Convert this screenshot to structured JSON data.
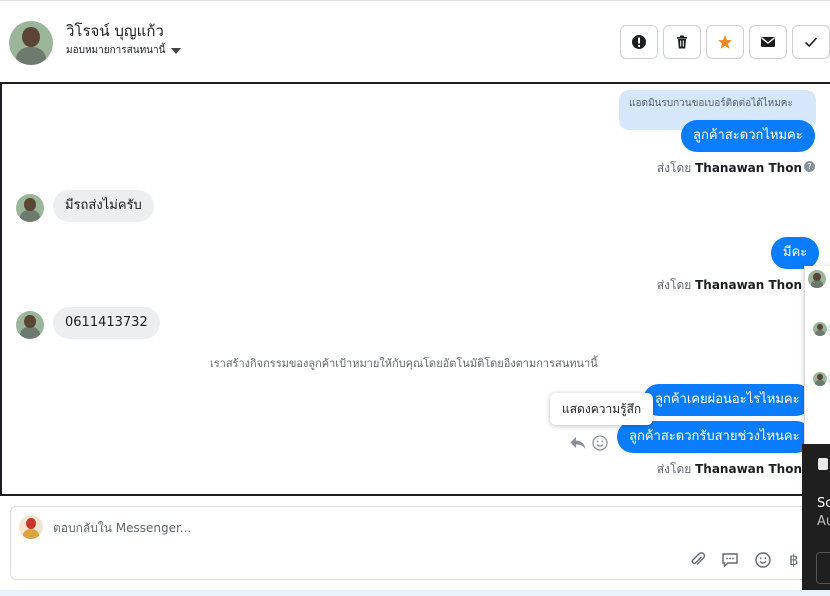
{
  "header": {
    "contact_name": "วิโรจน์ บุญแก้ว",
    "assign_label": "มอบหมายการสนทนานี้",
    "actions": [
      {
        "name": "spam-button",
        "icon": "exclamation-icon"
      },
      {
        "name": "delete-button",
        "icon": "trash-icon"
      },
      {
        "name": "star-button",
        "icon": "star-icon",
        "color": "#f28a23"
      },
      {
        "name": "mark-unread-button",
        "icon": "envelope-icon"
      },
      {
        "name": "done-button",
        "icon": "check-icon"
      }
    ]
  },
  "thread": {
    "note_text": "แอดมินรบกวนขอเบอร์ติดต่อได้ไหมคะ",
    "messages": {
      "m1": "ลูกค้าสะดวกไหมคะ",
      "m2": "มีรถส่งไม่ครับ",
      "m3": "มีคะ",
      "m4": "0611413732",
      "m5": "ลูกค้าเคยผ่อนอะไรไหมคะ",
      "m6": "ลูกค้าสะดวกรับสายช่วงไหนคะ"
    },
    "sent_by_prefix": "ส่งโดย",
    "sent_by_name": "Thanawan Thon",
    "help_mark": "?",
    "system_note": "เราสร้างกิจกรรมของลูกค้าเป้าหมายให้กับคุณโดยอัตโนมัติโดยอิงตามการสนทนานี้",
    "tooltip": "แสดงความรู้สึก"
  },
  "composer": {
    "placeholder": "ตอบกลับใน Messenger...",
    "currency_symbol": "฿"
  },
  "overlay": {
    "line1": "Sc",
    "line2": "Au"
  },
  "colors": {
    "outgoing": "#0a7cff",
    "incoming": "#eceef0",
    "note": "#d6e7fb",
    "star": "#f28a23"
  }
}
